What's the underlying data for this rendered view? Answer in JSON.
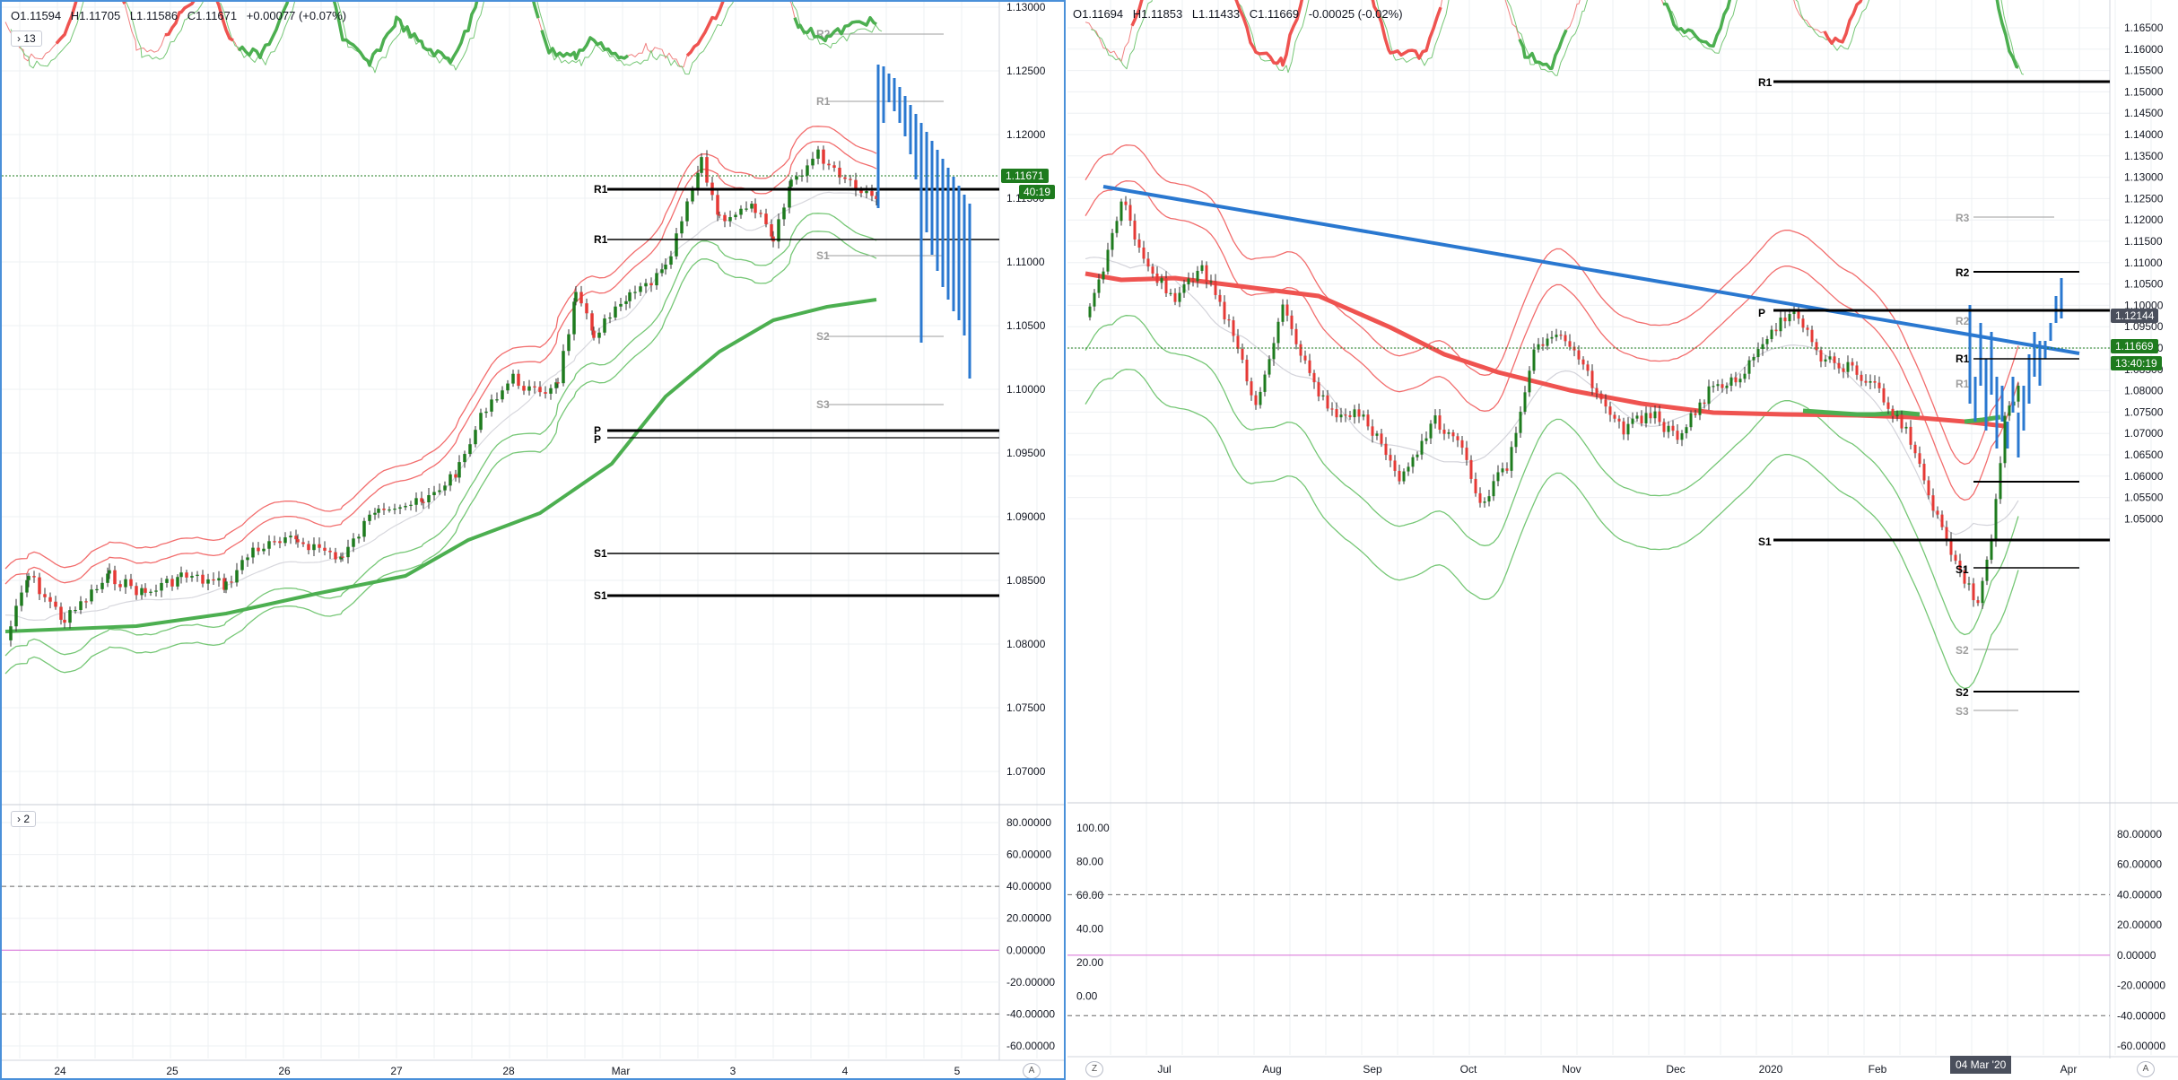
{
  "colors": {
    "bull": "#1e7b1e",
    "bear": "#e53935",
    "blue": "#2a78d0",
    "band_red": "#f26d6d",
    "band_green": "#76c776",
    "ma_green": "#4caf50",
    "ma_red": "#ef5350",
    "grid": "#eef0f3"
  },
  "left": {
    "ohlc": {
      "o": "O1.11594",
      "h": "H1.11705",
      "l": "L1.11586",
      "c": "C1.11671",
      "chg": "+0.00077 (+0.07%)"
    },
    "main_toggle": "13",
    "osc_toggle": "2",
    "price_labels": [
      "1.13000",
      "1.12500",
      "1.12000",
      "1.11500",
      "1.11000",
      "1.10500",
      "1.10000",
      "1.09500",
      "1.09000",
      "1.08500",
      "1.08000",
      "1.07500",
      "1.07000"
    ],
    "last_price": "1.11671",
    "countdown": "40:19",
    "osc_labels": [
      "80.00000",
      "60.00000",
      "40.00000",
      "20.00000",
      "0.00000",
      "-20.00000",
      "-40.00000",
      "-60.00000"
    ],
    "dates": [
      "24",
      "25",
      "26",
      "27",
      "28",
      "Mar",
      "3",
      "4",
      "5"
    ],
    "axis_btn": "A",
    "pivot_labels": {
      "r2": "R2",
      "r1a": "R1",
      "r1": "R1",
      "r1b": "R1",
      "s1a": "S1",
      "s2a": "S2",
      "s3a": "S3",
      "p1": "P",
      "p2": "P",
      "s1": "S1",
      "s1b": "S1"
    }
  },
  "right": {
    "ohlc": {
      "o": "O1.11694",
      "h": "H1.11853",
      "l": "L1.11433",
      "c": "C1.11669",
      "chg": "-0.00025 (-0.02%)"
    },
    "price_labels": [
      "1.16500",
      "1.16000",
      "1.15500",
      "1.15000",
      "1.14500",
      "1.14000",
      "1.13500",
      "1.13000",
      "1.12500",
      "1.12000",
      "1.11500",
      "1.11000",
      "1.10500",
      "1.10000",
      "1.09500",
      "1.09000",
      "1.08500",
      "1.08000",
      "1.07500",
      "1.07000",
      "1.06500",
      "1.06000",
      "1.05500",
      "1.05000"
    ],
    "line_price": "1.12144",
    "last_price": "1.11669",
    "countdown": "13:40:19",
    "osc_left_labels": [
      "100.00",
      "80.00",
      "60.00",
      "40.00",
      "20.00",
      "0.00"
    ],
    "osc_right_labels": [
      "80.00000",
      "60.00000",
      "40.00000",
      "20.00000",
      "0.00000",
      "-20.00000",
      "-40.00000",
      "-60.00000"
    ],
    "dates": [
      "Jul",
      "Aug",
      "Sep",
      "Oct",
      "Nov",
      "Dec",
      "2020",
      "Feb",
      "Apr"
    ],
    "crosshair_date": "04 Mar '20",
    "z_btn": "Z",
    "axis_btn": "A",
    "pivot_labels": {
      "r1": "R1",
      "r3": "R3",
      "r2": "R2",
      "r2b": "R2",
      "r1b": "R1",
      "r1c": "R1",
      "p": "P",
      "s1": "S1",
      "s1b": "S1",
      "s2": "S2",
      "s2b": "S2",
      "s3": "S3"
    }
  }
}
